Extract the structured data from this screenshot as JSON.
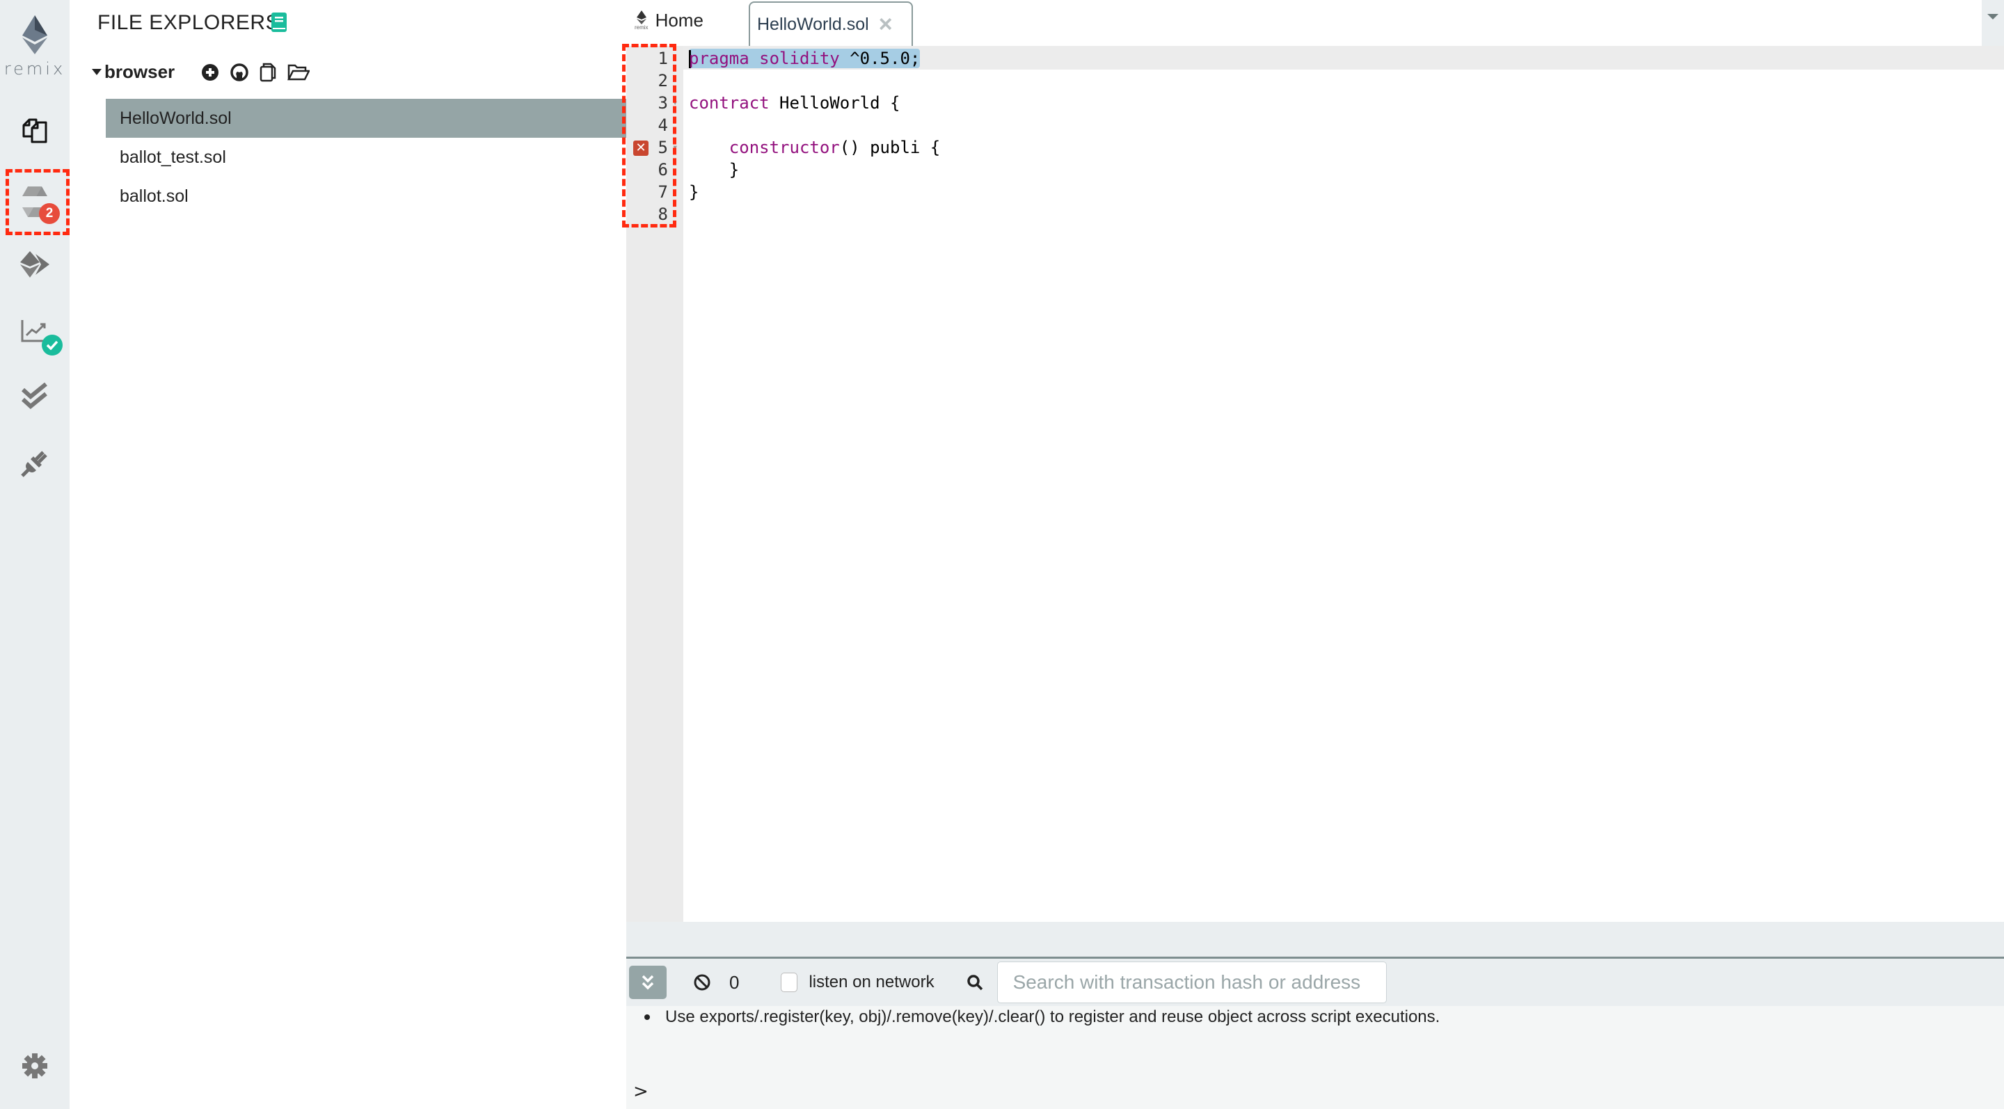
{
  "app": {
    "name": "remix",
    "accent_color": "#95a5a6",
    "error_color": "#e74c3c",
    "success_color": "#1abc9c",
    "highlight_color": "#ff2a10"
  },
  "icon_panel": {
    "logo_text": "remix",
    "items": [
      {
        "name": "file-explorers",
        "icon": "files-icon"
      },
      {
        "name": "solidity-compiler",
        "icon": "solidity-icon",
        "badge": "2",
        "badge_color": "#e74c3c",
        "highlighted": true
      },
      {
        "name": "deploy-run",
        "icon": "ethereum-deploy-icon"
      },
      {
        "name": "analysis",
        "icon": "chart-icon",
        "status": "check",
        "status_color": "#1abc9c"
      },
      {
        "name": "testing",
        "icon": "double-check-icon"
      },
      {
        "name": "plugin-manager",
        "icon": "plug-icon"
      }
    ],
    "settings_icon": "gear-icon"
  },
  "explorer": {
    "title": "FILE EXPLORERS",
    "root": {
      "label": "browser",
      "actions": [
        "add-file",
        "github-gist",
        "copy",
        "open-folder"
      ]
    },
    "files": [
      {
        "name": "HelloWorld.sol",
        "active": true
      },
      {
        "name": "ballot_test.sol",
        "active": false
      },
      {
        "name": "ballot.sol",
        "active": false
      }
    ]
  },
  "editor": {
    "tabs": [
      {
        "label": "Home",
        "active": false
      },
      {
        "label": "HelloWorld.sol",
        "active": true,
        "close": "×"
      }
    ],
    "lines": [
      {
        "n": "1",
        "code": ""
      },
      {
        "n": "2",
        "code": ""
      },
      {
        "n": "3",
        "code": ""
      },
      {
        "n": "4",
        "code": ""
      },
      {
        "n": "5",
        "code": "",
        "error": true
      },
      {
        "n": "6",
        "code": "    }"
      },
      {
        "n": "7",
        "code": "}"
      },
      {
        "n": "8",
        "code": ""
      }
    ],
    "tokens": {
      "l1_kw": "pragma solidity",
      "l1_rest": " ^0.5.0;",
      "l3_kw": "contract",
      "l3_rest": " HelloWorld {",
      "l5_indent": "    ",
      "l5_kw": "constructor",
      "l5_rest": "() publi {"
    }
  },
  "terminal": {
    "pending_count": "0",
    "listen_label": "listen on network",
    "listen_checked": false,
    "search_placeholder": "Search with transaction hash or address",
    "search_value": "",
    "messages": [
      "Use exports/.register(key, obj)/.remove(key)/.clear() to register and reuse object across script executions."
    ],
    "prompt": ">"
  }
}
